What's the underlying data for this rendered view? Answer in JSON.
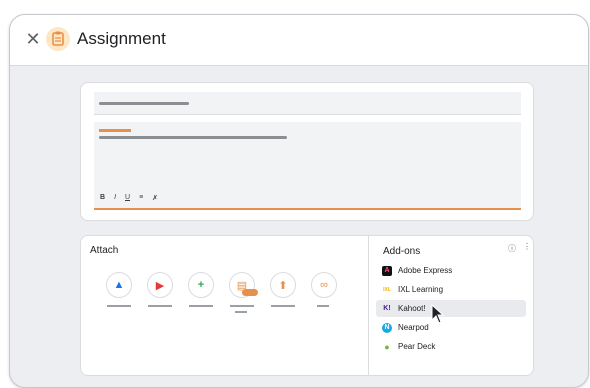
{
  "window": {
    "title": "Assignment"
  },
  "editor": {
    "toolbar": {
      "bold": "B",
      "italic": "I",
      "underline": "U",
      "list": "≡",
      "clear": "✗"
    }
  },
  "attach": {
    "label": "Attach",
    "items": [
      {
        "name": "drive",
        "icon": "google-drive-icon",
        "glyph": "▲",
        "color": "#1a73e8"
      },
      {
        "name": "youtube",
        "icon": "youtube-icon",
        "glyph": "▶",
        "color": "#e53935"
      },
      {
        "name": "create",
        "icon": "plus-icon",
        "glyph": "+",
        "color": "#34a853"
      },
      {
        "name": "document",
        "icon": "document-icon",
        "glyph": "▤",
        "color": "#e8904a"
      },
      {
        "name": "upload",
        "icon": "upload-icon",
        "glyph": "⬆",
        "color": "#e8904a"
      },
      {
        "name": "link",
        "icon": "link-icon",
        "glyph": "∞",
        "color": "#e8904a"
      }
    ]
  },
  "addons": {
    "title": "Add-ons",
    "items": [
      {
        "label": "Adobe Express",
        "icon": "adobe-express-icon",
        "glyph": "Ae",
        "color": "#111111",
        "text_color": "#ff4f8b"
      },
      {
        "label": "IXL Learning",
        "icon": "ixl-icon",
        "glyph": "IXL",
        "color": "#ffffff",
        "text_color": "#f4b400"
      },
      {
        "label": "Kahoot!",
        "icon": "kahoot-icon",
        "glyph": "K!",
        "color": "#ffffff",
        "text_color": "#46178f"
      },
      {
        "label": "Nearpod",
        "icon": "nearpod-icon",
        "glyph": "N",
        "color": "#1ba7e1",
        "text_color": "#ffffff"
      },
      {
        "label": "Pear Deck",
        "icon": "pear-deck-icon",
        "glyph": "●",
        "color": "#ffffff",
        "text_color": "#7cb342"
      }
    ]
  }
}
